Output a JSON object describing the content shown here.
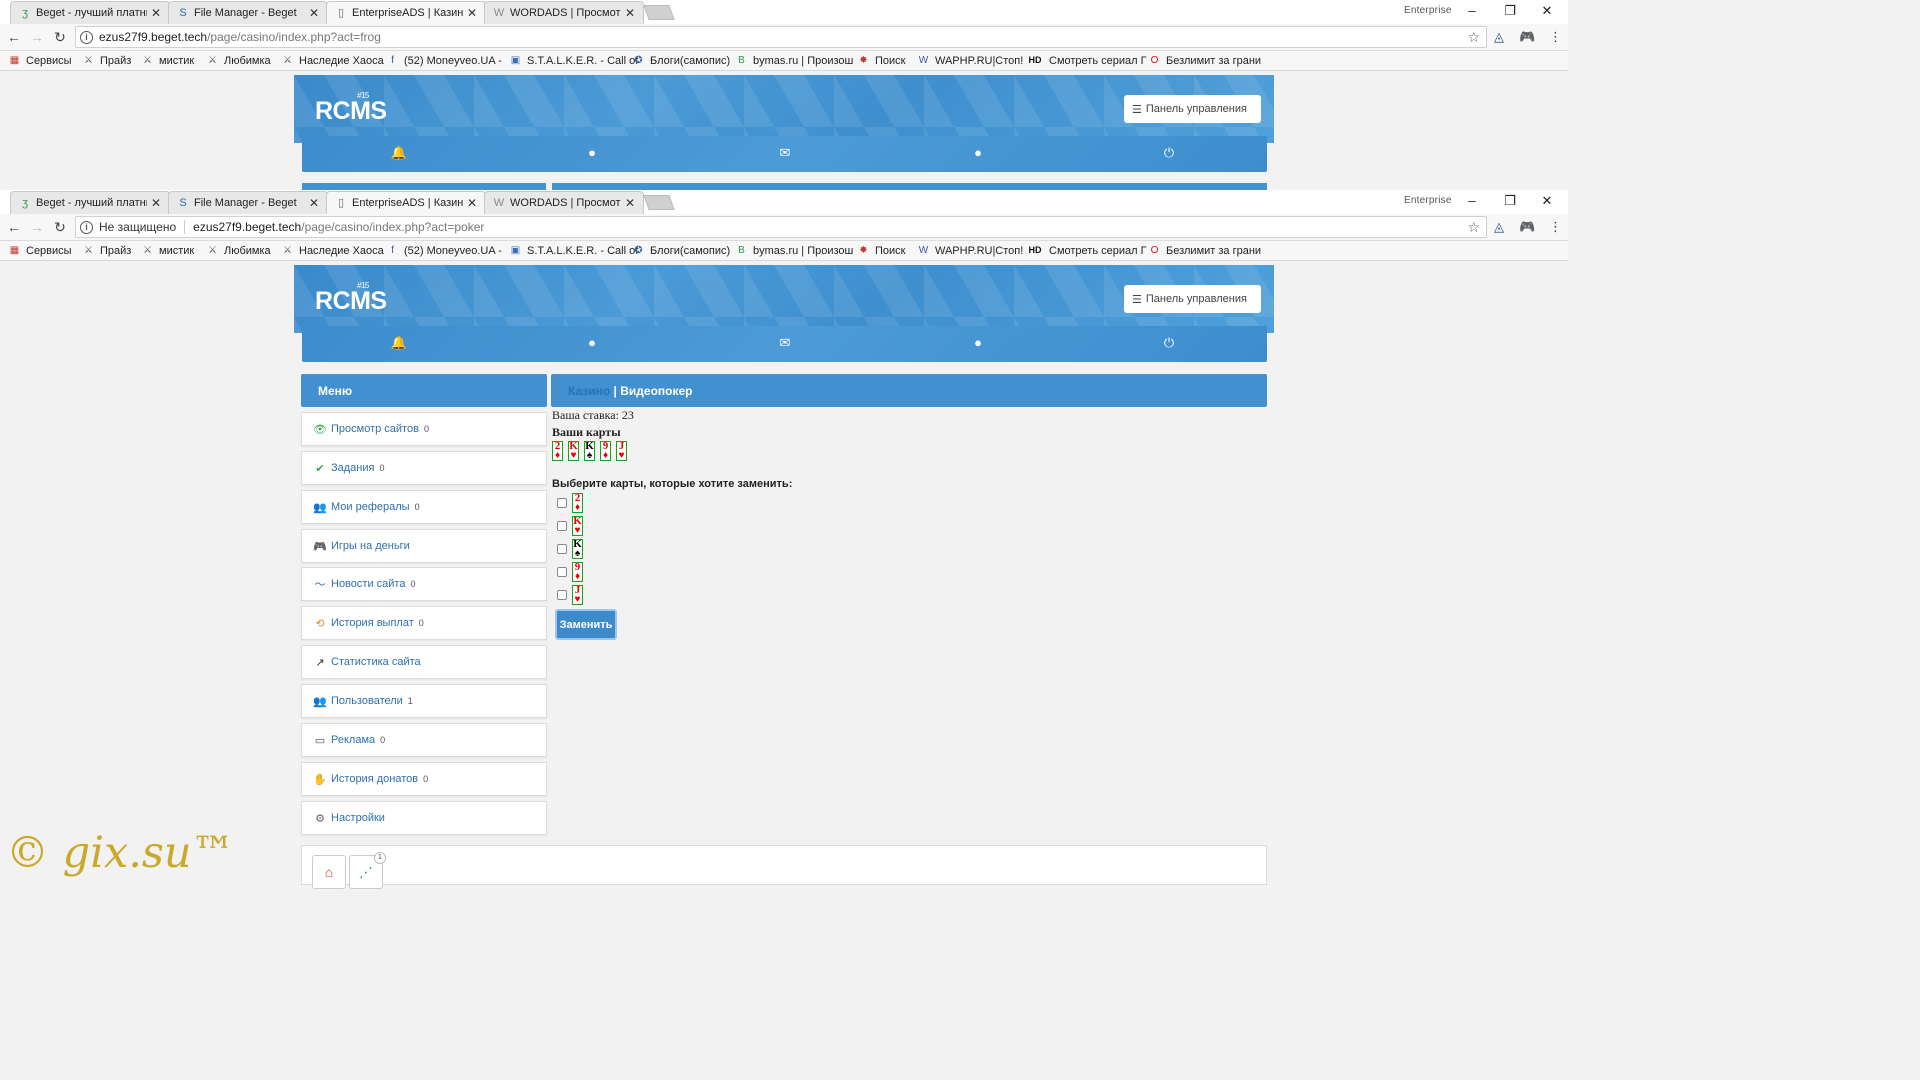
{
  "browser": {
    "tabs": [
      {
        "title": "Beget - лучший платный",
        "icon": "beget-icon"
      },
      {
        "title": "File Manager - Beget",
        "icon": "filemanager-icon"
      },
      {
        "title": "EnterpriseADS | Казино",
        "icon": "page-icon"
      },
      {
        "title": "WORDADS | Просмотр т",
        "icon": "wordads-icon"
      }
    ],
    "profile": "Enterprise",
    "top_url": {
      "host": "ezus27f9.beget.tech",
      "path": "/page/casino/index.php?act=frog"
    },
    "bottom_url": {
      "insecure_label": "Не защищено",
      "host": "ezus27f9.beget.tech",
      "path": "/page/casino/index.php?act=poker"
    },
    "bookmarks": [
      "Сервисы",
      "Прайз",
      "мистик",
      "Любимка",
      "Наследие Хаоса",
      "(52) Moneyveo.UA -",
      "S.T.A.L.K.E.R. - Call of",
      "Блоги(самопис)",
      "bymas.ru | Произош",
      "Поиск",
      "WAPHP.RU|Стоп!",
      "Смотреть сериал Г",
      "Безлимит за грани"
    ]
  },
  "site": {
    "logo": "RCMS",
    "logo_sup": "#15",
    "control_panel": "Панель управления",
    "menu_title": "Меню",
    "menu": [
      {
        "label": "Просмотр сайтов",
        "count": "0",
        "icon": "eye-icon",
        "glyph": "👁",
        "color": "#3aa64a"
      },
      {
        "label": "Задания",
        "count": "0",
        "icon": "check-icon",
        "glyph": "✔",
        "color": "#3aa64a"
      },
      {
        "label": "Мои рефералы",
        "count": "0",
        "icon": "referrals-icon",
        "glyph": "👥",
        "color": "#2f6fb0"
      },
      {
        "label": "Игры на деньги",
        "count": "",
        "icon": "gamepad-icon",
        "glyph": "🎮",
        "color": "#2f6fb0"
      },
      {
        "label": "Новости сайта",
        "count": "0",
        "icon": "rss-icon",
        "glyph": "〜",
        "color": "#2f6fb0"
      },
      {
        "label": "История выплат",
        "count": "0",
        "icon": "history-icon",
        "glyph": "⟲",
        "color": "#e8862a"
      },
      {
        "label": "Статистика сайта",
        "count": "",
        "icon": "stats-icon",
        "glyph": "↗",
        "color": "#333"
      },
      {
        "label": "Пользователи",
        "count": "1",
        "icon": "users-icon",
        "glyph": "👥",
        "color": "#666"
      },
      {
        "label": "Реклама",
        "count": "0",
        "icon": "monitor-icon",
        "glyph": "▭",
        "color": "#555"
      },
      {
        "label": "История донатов",
        "count": "0",
        "icon": "donate-icon",
        "glyph": "✋",
        "color": "#e8862a"
      },
      {
        "label": "Настройки",
        "count": "",
        "icon": "gear-icon",
        "glyph": "⚙",
        "color": "#666"
      }
    ],
    "content": {
      "crumb": "Казино",
      "separator": " | ",
      "title": "Видеопокер",
      "bet": "Ваша ставка: 23",
      "cards_label": "Ваши карты",
      "choose_label": "Выберите карты, которые хотите заменить:",
      "cards": [
        {
          "rank": "2",
          "suit": "♦",
          "color": "red"
        },
        {
          "rank": "K",
          "suit": "♥",
          "color": "red"
        },
        {
          "rank": "K",
          "suit": "♠",
          "color": "black"
        },
        {
          "rank": "9",
          "suit": "♦",
          "color": "red"
        },
        {
          "rank": "J",
          "suit": "♥",
          "color": "red"
        }
      ],
      "replace_button": "Заменить"
    },
    "footer_badge": "1"
  },
  "watermark": "© gix.su™"
}
